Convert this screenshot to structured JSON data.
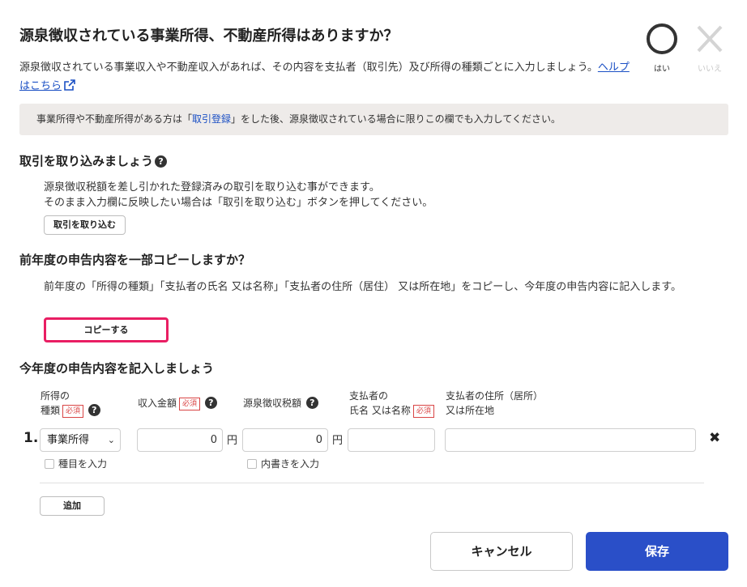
{
  "header": {
    "title": "源泉徴収されている事業所得、不動産所得はありますか？",
    "description": "源泉徴収されている事業収入や不動産収入があれば、その内容を支払者（取引先）及び所得の種類ごとに入力しましょう。",
    "help_link": "ヘルプはこちら"
  },
  "answer": {
    "yes_label": "はい",
    "no_label": "いいえ",
    "selected": "yes"
  },
  "notice": {
    "prefix": "事業所得や不動産所得がある方は「",
    "link": "取引登録",
    "suffix": "」をした後、源泉徴収されている場合に限りこの欄でも入力してください。"
  },
  "import_section": {
    "title": "取引を取り込みましょう",
    "line1": "源泉徴収税額を差し引かれた登録済みの取引を取り込む事ができます。",
    "line2": "そのまま入力欄に反映したい場合は「取引を取り込む」ボタンを押してください。",
    "button": "取引を取り込む"
  },
  "copy_section": {
    "title": "前年度の申告内容を一部コピーしますか？",
    "body": "前年度の「所得の種類」「支払者の氏名 又は名称」「支払者の住所（居住） 又は所在地」をコピーし、今年度の申告内容に記入します。",
    "button": "コピーする"
  },
  "entry_section": {
    "title": "今年度の申告内容を記入しましょう",
    "required_label": "必須",
    "columns": {
      "income_type_1": "所得の",
      "income_type_2": "種類",
      "revenue": "収入金額",
      "withholding": "源泉徴収税額",
      "payer_name_1": "支払者の",
      "payer_name_2": "氏名 又は名称",
      "payer_address_1": "支払者の住所（居所）",
      "payer_address_2": "又は所在地"
    },
    "rows": [
      {
        "number": "1.",
        "income_type": "事業所得",
        "revenue": "0",
        "withholding": "0",
        "unit": "円",
        "payer_name": "",
        "payer_address": "",
        "item_checkbox": "種目を入力",
        "breakdown_checkbox": "内書きを入力"
      }
    ],
    "add_button": "追加"
  },
  "footer": {
    "cancel": "キャンセル",
    "save": "保存"
  },
  "colors": {
    "primary": "#2a4fc8",
    "highlight": "#e91e63",
    "required": "#d94545",
    "notice_bg": "#eeebe9"
  }
}
